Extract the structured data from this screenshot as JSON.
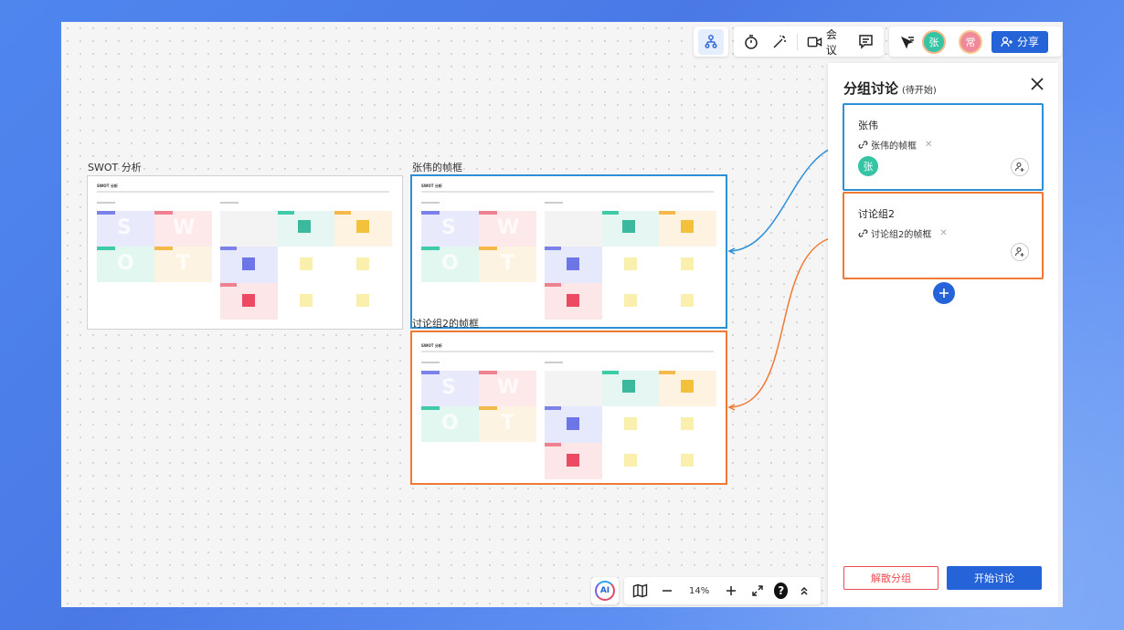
{
  "toolbar": {
    "meeting_label": "会议",
    "avatar1": "张",
    "avatar2": "常",
    "share_label": "分享"
  },
  "canvas": {
    "frames": [
      {
        "label": "SWOT 分析",
        "inner_title": "SWOT 分析"
      },
      {
        "label": "张伟的帧框",
        "inner_title": "SWOT 分析"
      },
      {
        "label": "讨论组2的帧框",
        "inner_title": "SWOT 分析"
      }
    ],
    "swot_letters": [
      "S",
      "W",
      "O",
      "T"
    ]
  },
  "panel": {
    "title": "分组讨论",
    "status": "(待开始)",
    "groups": [
      {
        "name": "张伟",
        "frame_link": "张伟的帧框",
        "member": "张"
      },
      {
        "name": "讨论组2",
        "frame_link": "讨论组2的帧框"
      }
    ],
    "disband_label": "解散分组",
    "start_label": "开始讨论"
  },
  "bottombar": {
    "ai_label": "AI",
    "zoom": "14%"
  },
  "colors": {
    "accent": "#2463d8",
    "group1": "#2d8fd6",
    "group2": "#f07a33",
    "danger": "#ef4c52"
  }
}
